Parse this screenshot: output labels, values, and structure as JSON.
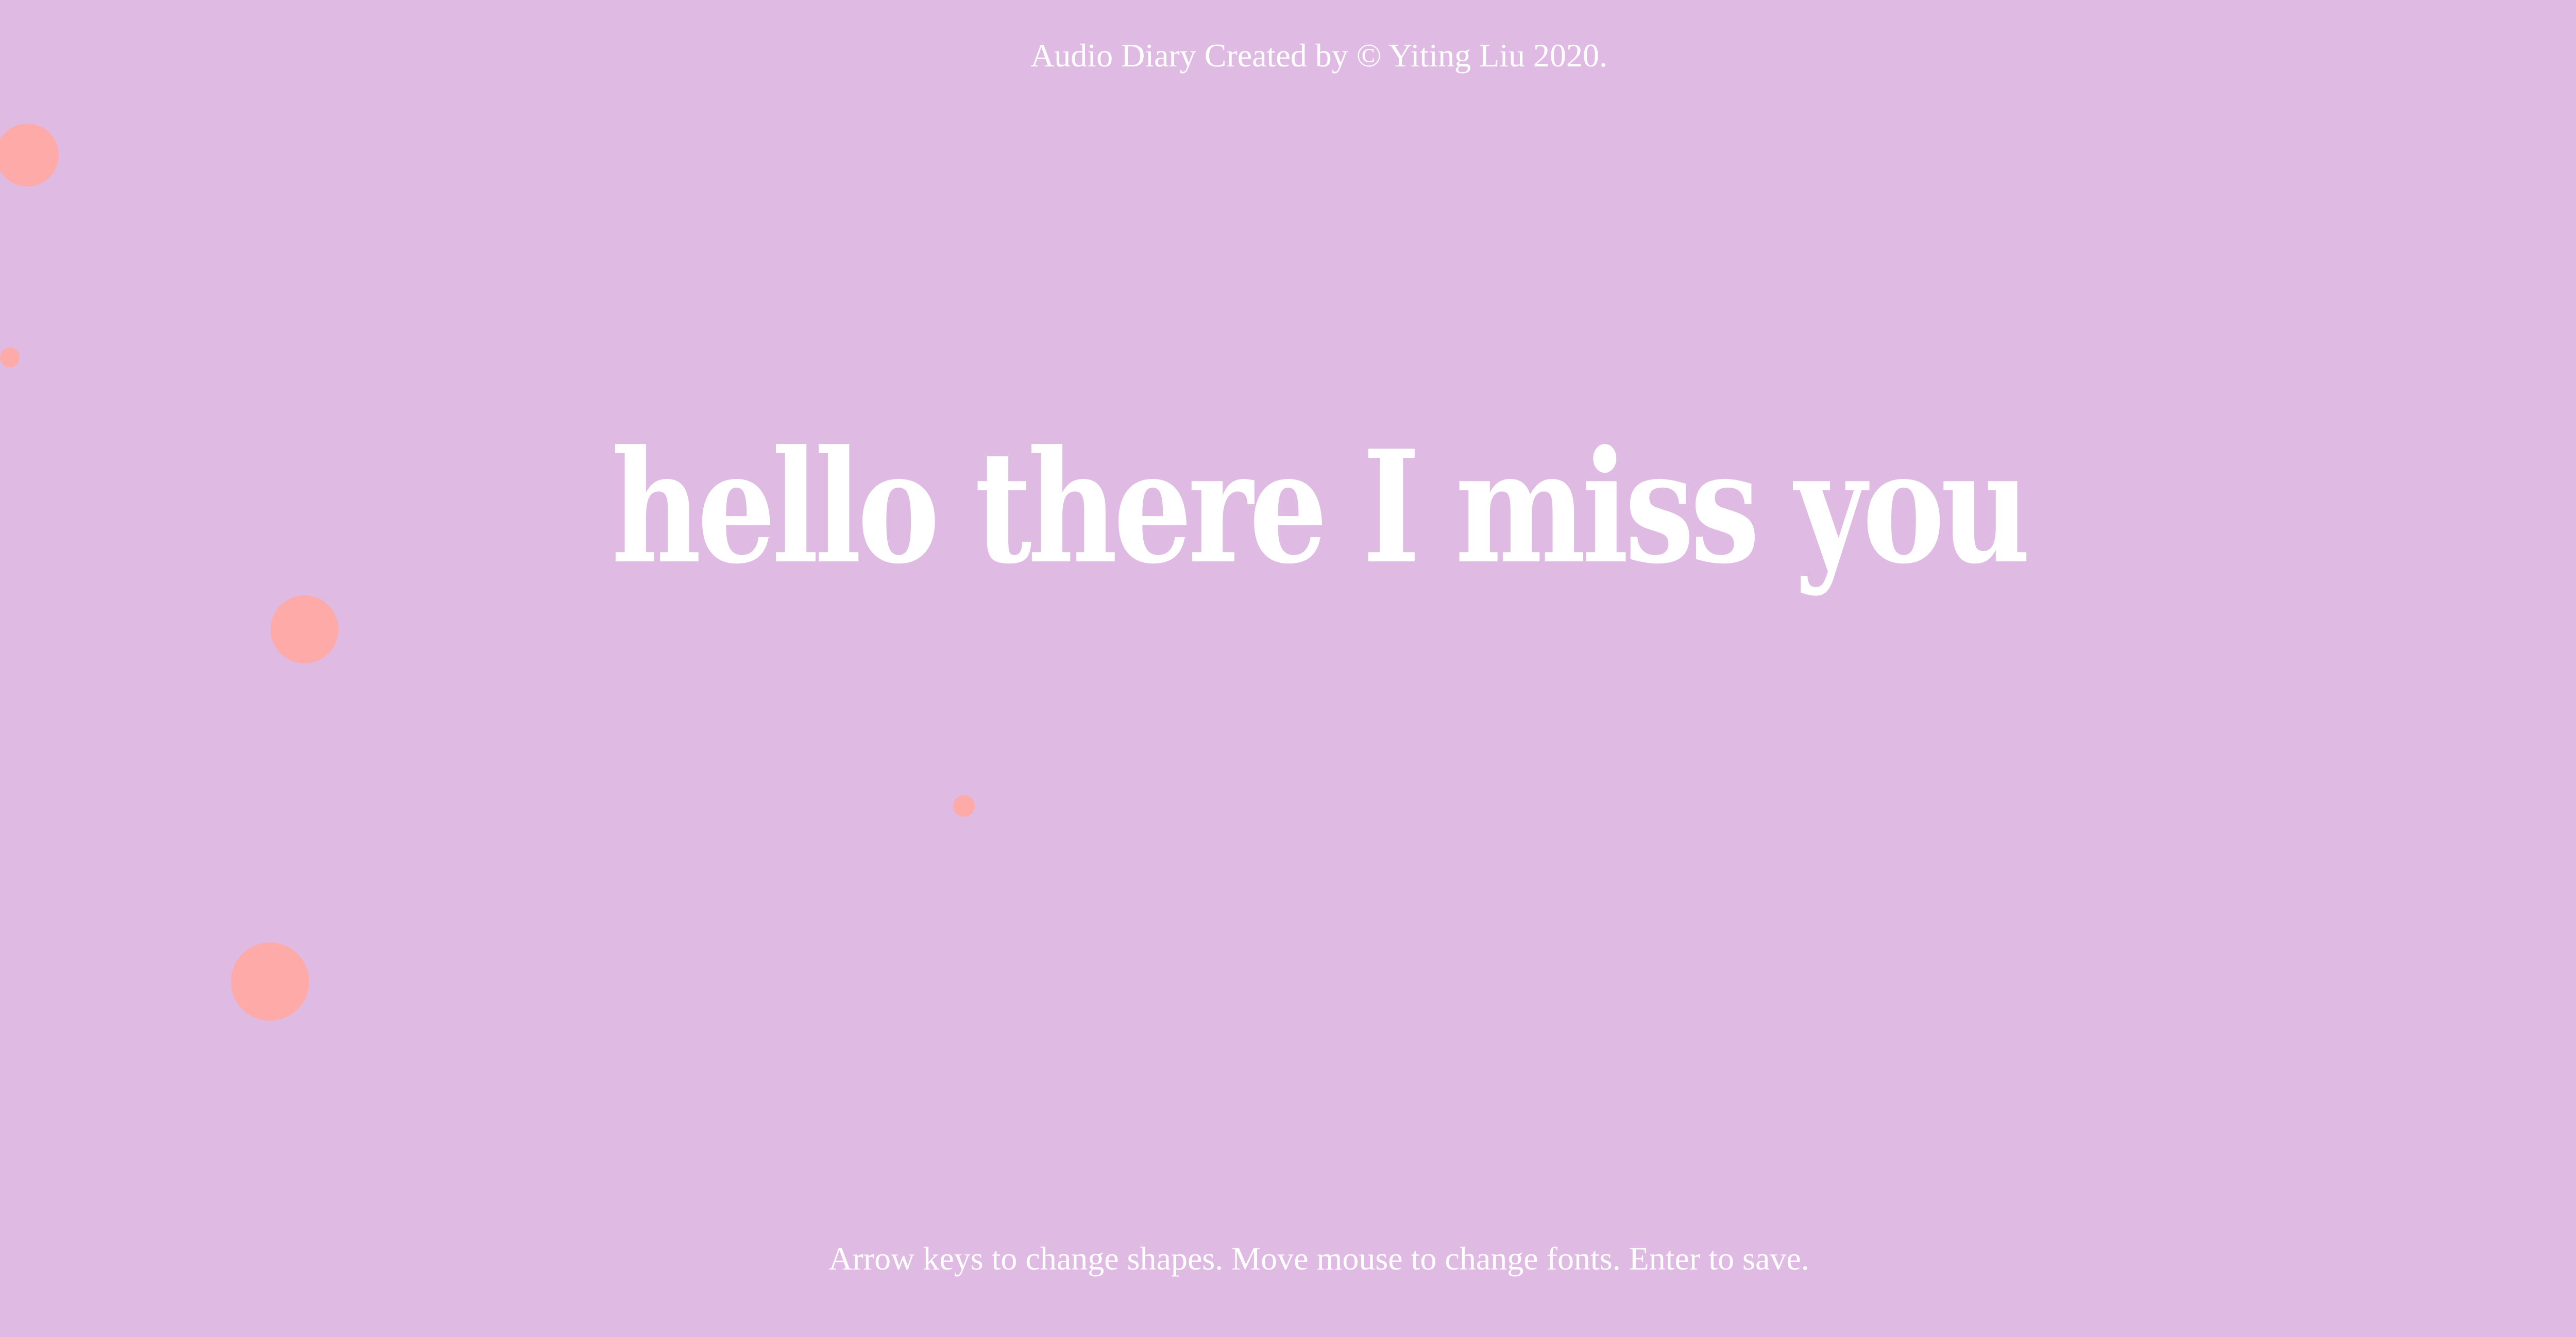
{
  "header": {
    "credit_text": "Audio Diary Created by © Yiting Liu 2020."
  },
  "canvas": {
    "display_text": "hello there I miss you",
    "dot_color": "#fdaaa9",
    "background_color": "#dfbae2",
    "text_color": "#ffffff"
  },
  "footer": {
    "instructions": "Arrow keys to change shapes. Move mouse to change fonts. Enter to save."
  }
}
